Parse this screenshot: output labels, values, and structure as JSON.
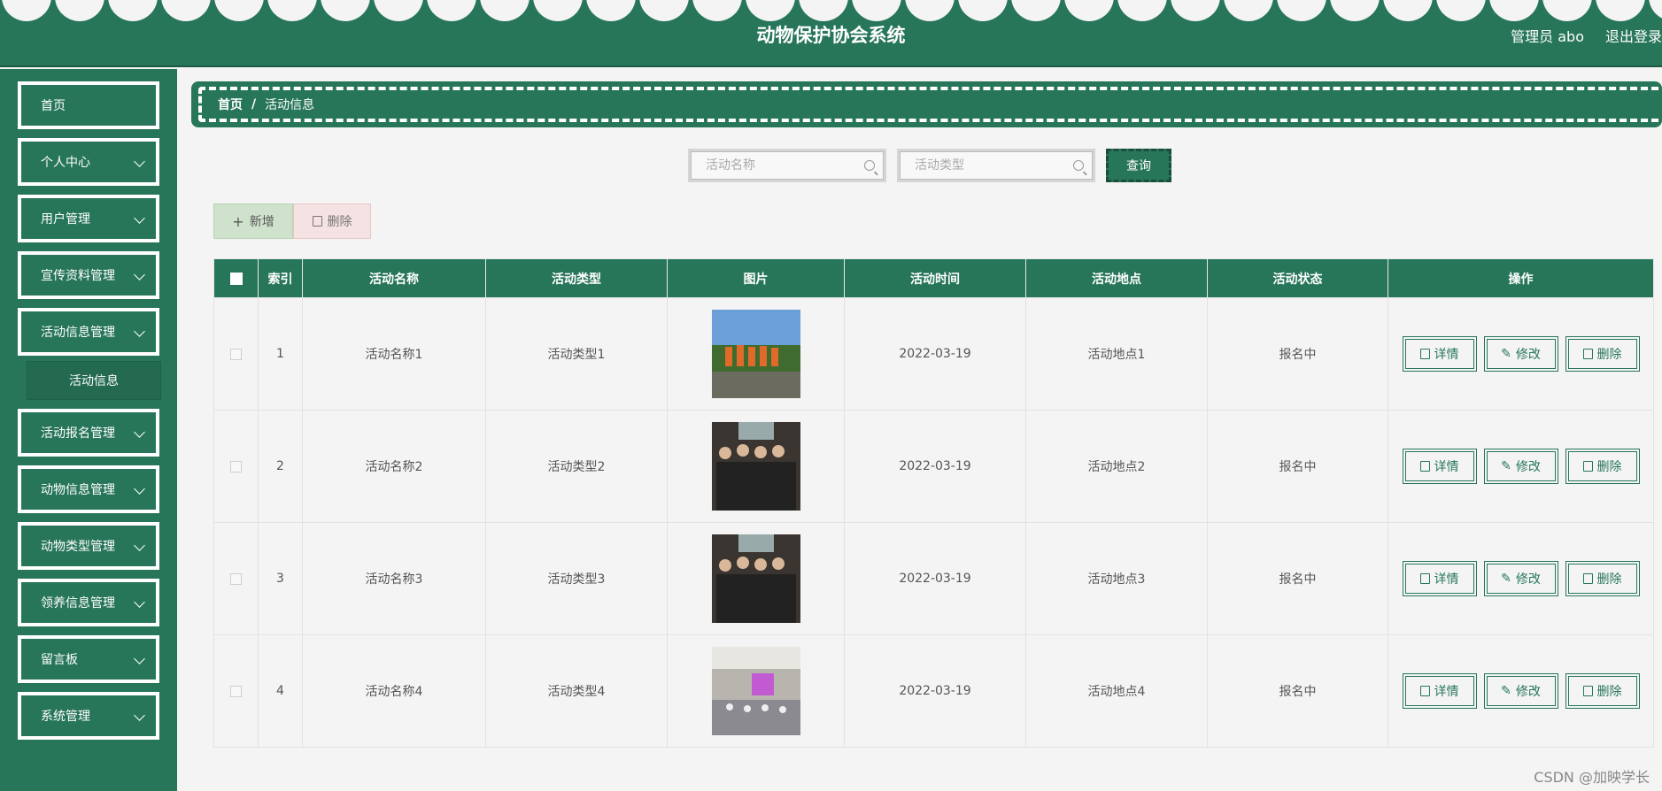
{
  "header": {
    "title": "动物保护协会系统",
    "user": "管理员 abo",
    "logout": "退出登录"
  },
  "sidebar": {
    "items": [
      {
        "label": "首页",
        "top": 0
      },
      {
        "label": "个人中心"
      },
      {
        "label": "用户管理"
      },
      {
        "label": "宣传资料管理"
      },
      {
        "label": "活动信息管理"
      },
      {
        "label": "活动报名管理"
      },
      {
        "label": "动物信息管理"
      },
      {
        "label": "动物类型管理"
      },
      {
        "label": "领养信息管理"
      },
      {
        "label": "留言板"
      },
      {
        "label": "系统管理"
      }
    ],
    "sub_item": "活动信息"
  },
  "breadcrumb": {
    "home": "首页",
    "sep": "/",
    "current": "活动信息"
  },
  "search": {
    "name_placeholder": "活动名称",
    "type_placeholder": "活动类型",
    "query": "查询"
  },
  "actions": {
    "add": "新增",
    "delete": "删除"
  },
  "table": {
    "headers": [
      "索引",
      "活动名称",
      "活动类型",
      "图片",
      "活动时间",
      "活动地点",
      "活动状态",
      "操作"
    ],
    "rows": [
      {
        "index": "1",
        "name": "活动名称1",
        "type": "活动类型1",
        "time": "2022-03-19",
        "place": "活动地点1",
        "status": "报名中"
      },
      {
        "index": "2",
        "name": "活动名称2",
        "type": "活动类型2",
        "time": "2022-03-19",
        "place": "活动地点2",
        "status": "报名中"
      },
      {
        "index": "3",
        "name": "活动名称3",
        "type": "活动类型3",
        "time": "2022-03-19",
        "place": "活动地点3",
        "status": "报名中"
      },
      {
        "index": "4",
        "name": "活动名称4",
        "type": "活动类型4",
        "time": "2022-03-19",
        "place": "活动地点4",
        "status": "报名中"
      }
    ],
    "ops": {
      "detail": "详情",
      "edit": "修改",
      "delete": "删除"
    }
  },
  "watermark": "CSDN @加映学长",
  "colors": {
    "primary": "#27765a",
    "bg": "#f4f4f4"
  }
}
